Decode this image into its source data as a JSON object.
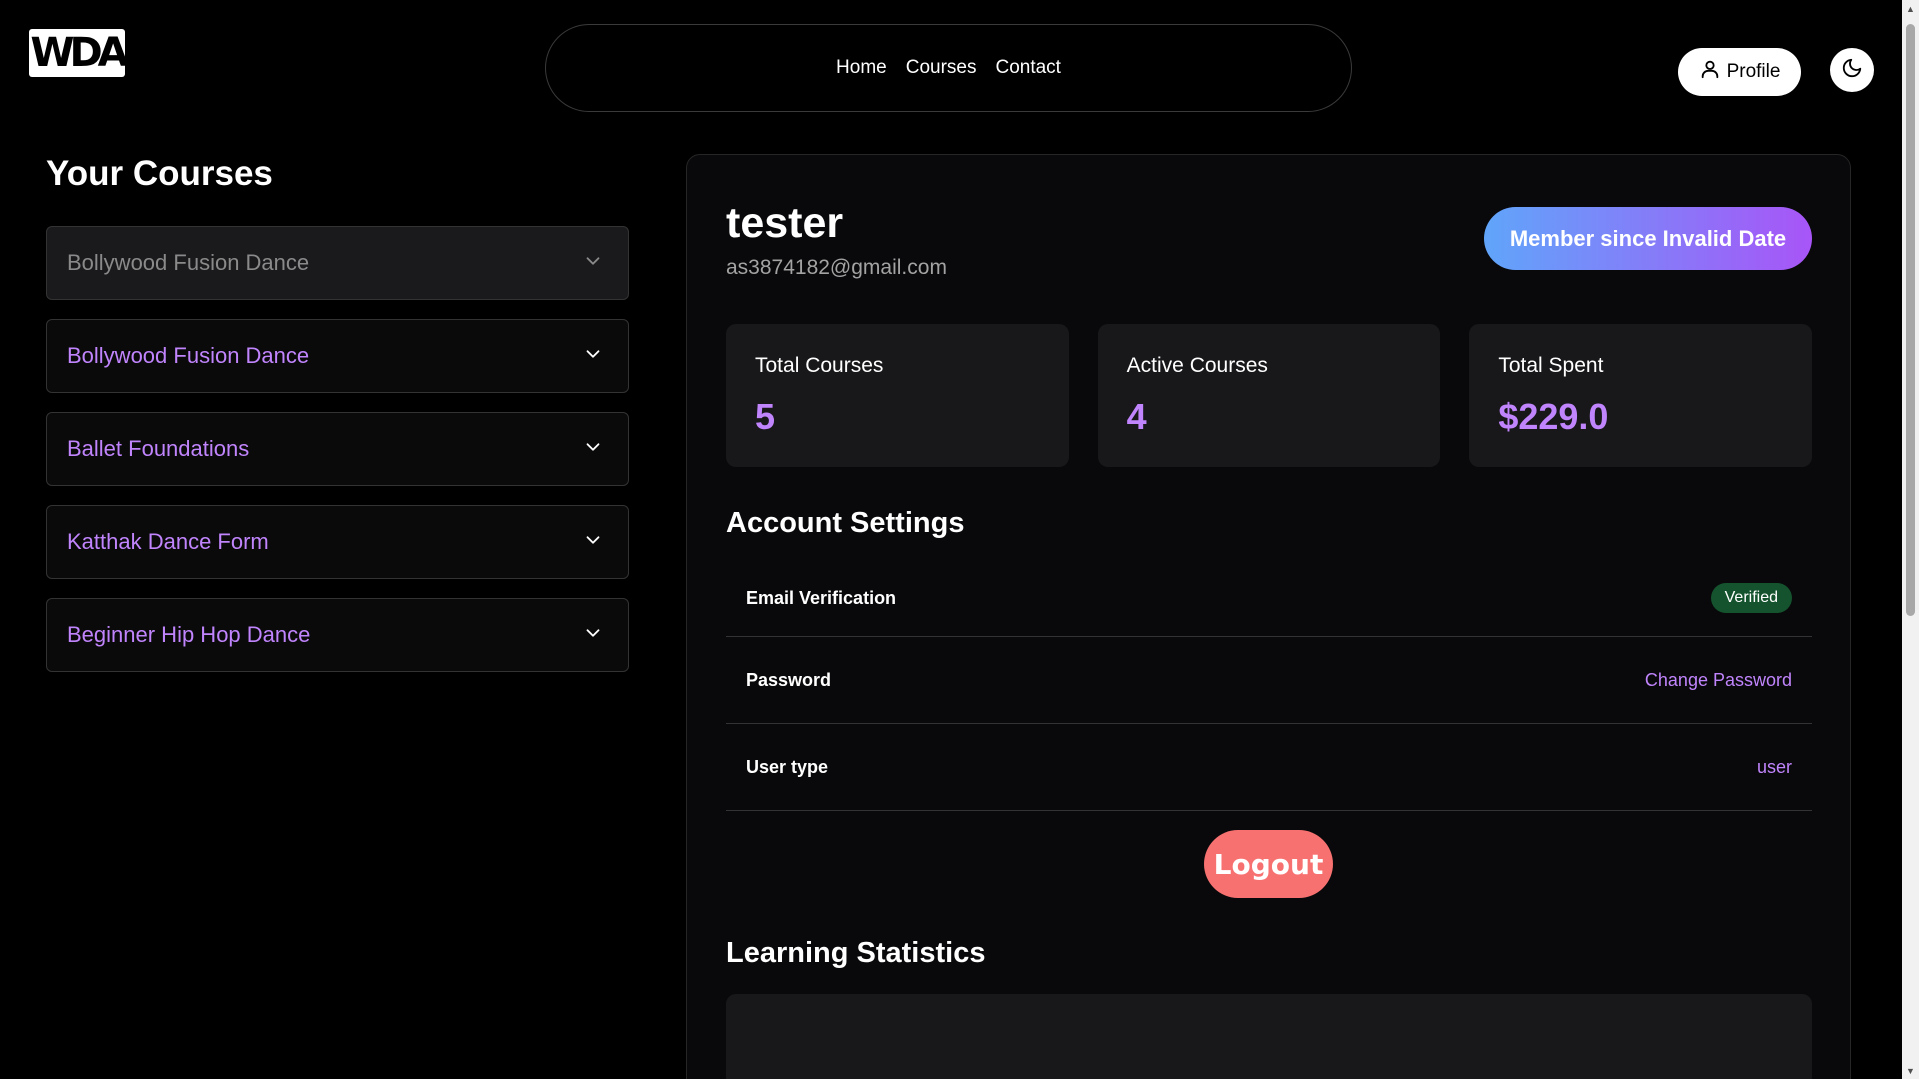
{
  "header": {
    "logo_text": "WDA",
    "nav": [
      "Home",
      "Courses",
      "Contact"
    ],
    "profile_label": "Profile",
    "theme_icon": "moon-icon"
  },
  "sidebar": {
    "title": "Your Courses",
    "courses": [
      {
        "label": "Bollywood Fusion Dance",
        "state": "dimmed"
      },
      {
        "label": "Bollywood Fusion Dance",
        "state": "active"
      },
      {
        "label": "Ballet Foundations",
        "state": "active"
      },
      {
        "label": "Katthak Dance Form",
        "state": "active"
      },
      {
        "label": "Beginner Hip Hop Dance",
        "state": "active"
      }
    ]
  },
  "profile": {
    "name": "tester",
    "email": "as3874182@gmail.com",
    "member_badge": "Member since Invalid Date",
    "stats": [
      {
        "label": "Total Courses",
        "value": "5"
      },
      {
        "label": "Active Courses",
        "value": "4"
      },
      {
        "label": "Total Spent",
        "value": "$229.0"
      }
    ],
    "account_settings_title": "Account Settings",
    "settings": {
      "email_label": "Email Verification",
      "email_status": "Verified",
      "password_label": "Password",
      "password_action": "Change Password",
      "usertype_label": "User type",
      "usertype_value": "user"
    },
    "logout_label": "Logout",
    "learning_title": "Learning Statistics"
  },
  "colors": {
    "accent": "#c084fc",
    "verified": "#14532d",
    "logout": "#f87171",
    "badge_gradient_start": "#60a5fa",
    "badge_gradient_end": "#a855f7"
  }
}
